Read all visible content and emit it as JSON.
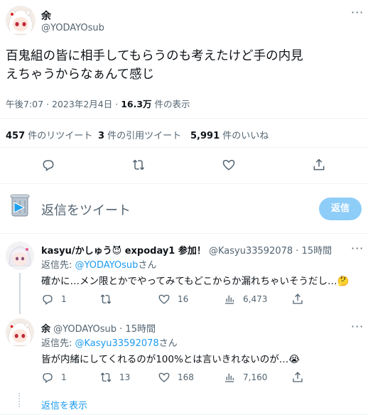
{
  "tweet": {
    "author_name": "余",
    "author_handle": "@YODAYOsub",
    "text_line1": "百鬼組の皆に相手してもらうのも考えたけど手の内見",
    "text_line2": "えちゃうからなぁんて感じ",
    "time": "午後7:07",
    "date": "2023年2月4日",
    "views_count": "16.3万",
    "views_label": " 件の表示",
    "separator": "·"
  },
  "stats": {
    "retweets_count": "457",
    "retweets_label": " 件のリツイート",
    "quotes_count": "3",
    "quotes_label": " 件の引用ツイート",
    "likes_count": "5,991",
    "likes_label": " 件のいいね"
  },
  "compose": {
    "placeholder": "返信をツイート",
    "reply_button": "返信"
  },
  "replies": [
    {
      "author_name": "kasyu/かしゅう😈 expoday1 参加！",
      "author_handle": "@Kasyu33592078",
      "time": "· 15時間",
      "replying_to_label": "返信先: ",
      "replying_to_handle": "@YODAYOsub",
      "replying_to_suffix": "さん",
      "text": "確かに…メン限とかでやってみてもどこからか漏れちゃいそうだし…🤔",
      "reply_count": "1",
      "retweet_count": "",
      "like_count": "16",
      "view_count": "6,473"
    },
    {
      "author_name": "余",
      "author_handle": "@YODAYOsub",
      "time": "· 15時間",
      "replying_to_label": "返信先: ",
      "replying_to_handle": "@Kasyu33592078",
      "replying_to_suffix": "さん",
      "text": "皆が内緒にしてくれるのが100%とは言いきれないのが…😭",
      "reply_count": "1",
      "retweet_count": "13",
      "like_count": "168",
      "view_count": "7,160"
    }
  ],
  "show_replies": "返信を表示",
  "colors": {
    "accent": "#1d9bf0",
    "reply_button_bg": "#8ecdf8",
    "text": "#0f1419",
    "muted": "#536471",
    "divider": "#eff3f4"
  }
}
